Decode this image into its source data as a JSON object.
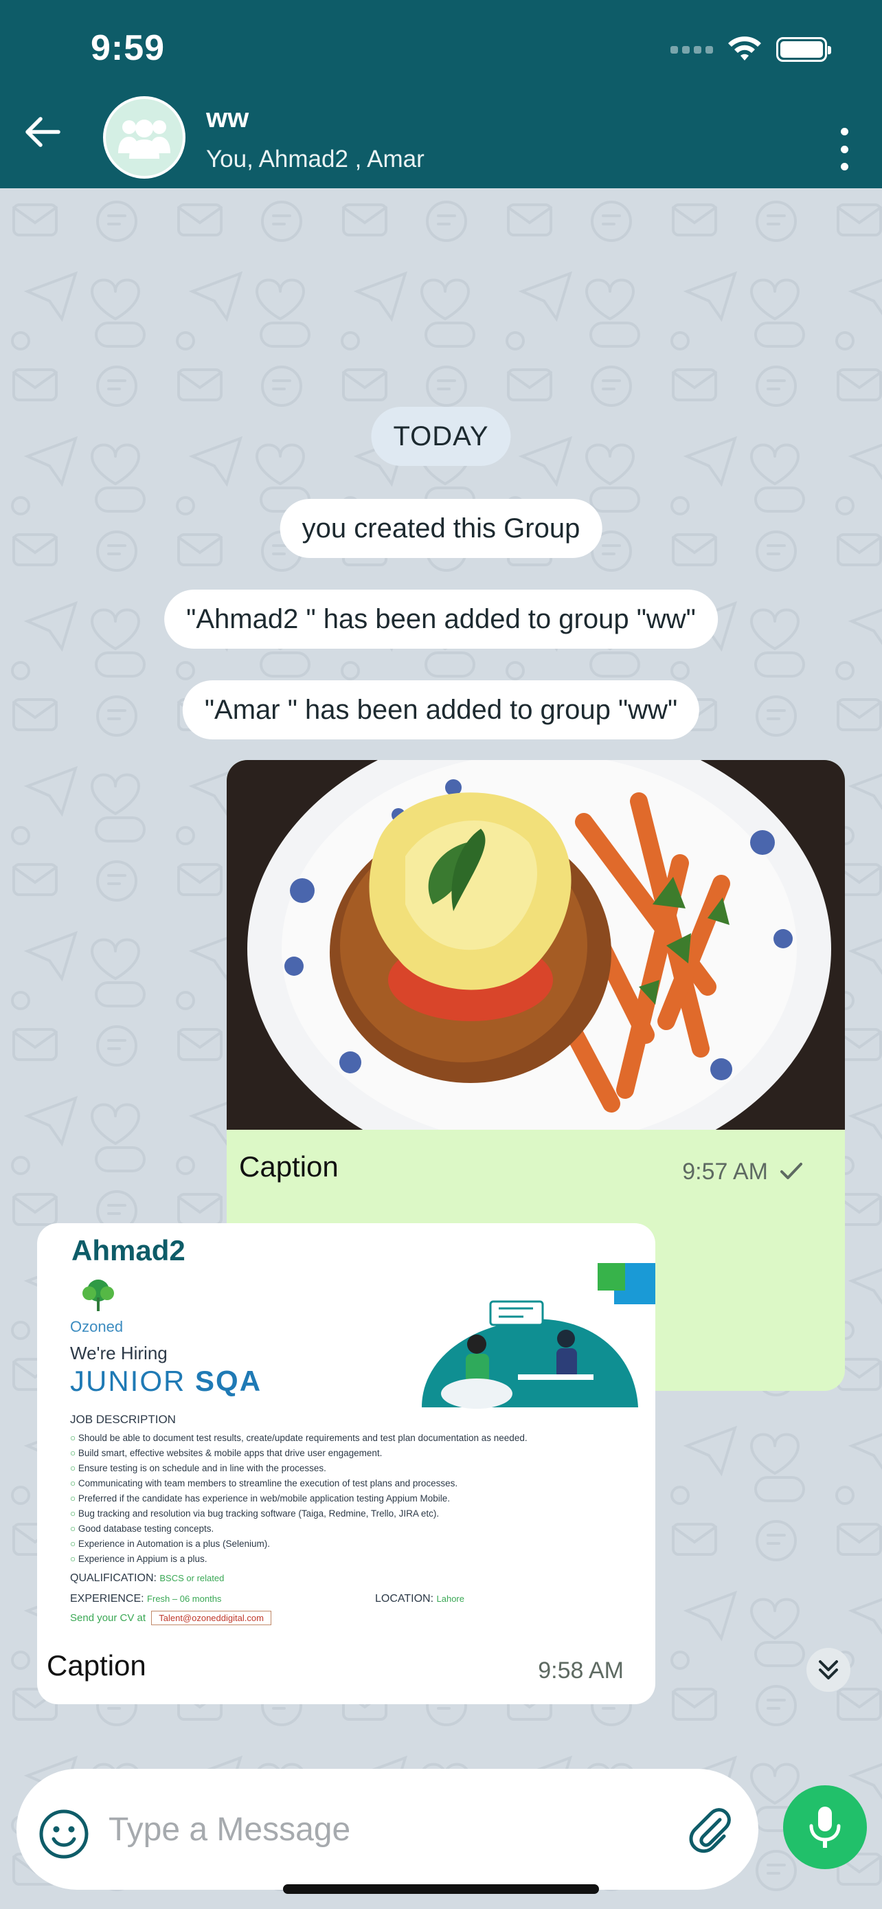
{
  "status_bar": {
    "time": "9:59"
  },
  "header": {
    "title": "ww",
    "members": "You, Ahmad2 , Amar",
    "avatar_icon": "group-icon",
    "back_icon": "arrow-left-icon",
    "menu_icon": "more-vertical-icon",
    "background_color": "#0e5c68"
  },
  "chat": {
    "date_label": "TODAY",
    "system_messages": [
      "you created this Group",
      "\"Ahmad2 \" has been added to group \"ww\"",
      "\"Amar \" has been added to group \"ww\""
    ],
    "outgoing_image": {
      "caption": "Caption",
      "time": "9:57 AM",
      "status_icon": "check-icon",
      "bubble_color": "#dcf8c6"
    },
    "incoming_image": {
      "sender": "Ahmad2",
      "caption": "Caption",
      "time": "9:58 AM",
      "poster": {
        "brand": "Ozoned",
        "hiring": "We're Hiring",
        "role_a": "JUNIOR",
        "role_b": "SQA",
        "section": "JOB DESCRIPTION",
        "bullets": [
          "Should be able to document test results, create/update requirements and test plan documentation as needed.",
          "Build smart, effective websites & mobile apps that drive user engagement.",
          "Ensure testing is on schedule and in line with the processes.",
          "Communicating with team members to streamline the execution of test plans and processes.",
          "Preferred if the candidate has experience in web/mobile application testing Appium Mobile.",
          "Bug tracking and resolution via bug tracking software (Taiga, Redmine, Trello, JIRA etc).",
          "Good database testing concepts.",
          "Experience in Automation is a plus (Selenium).",
          "Experience in Appium is a plus."
        ],
        "qualification_label": "QUALIFICATION:",
        "qualification_value": "BSCS or related",
        "experience_label": "EXPERIENCE:",
        "experience_value": "Fresh – 06 months",
        "location_label": "LOCATION:",
        "location_value": "Lahore",
        "cv_label": "Send your CV at",
        "cv_email": "Talent@ozoneddigital.com"
      }
    },
    "scroll_icon": "chevrons-down-icon"
  },
  "composer": {
    "placeholder": "Type a Message",
    "emoji_icon": "smiley-icon",
    "attach_icon": "paperclip-icon",
    "mic_icon": "microphone-icon",
    "mic_color": "#21c06a"
  }
}
